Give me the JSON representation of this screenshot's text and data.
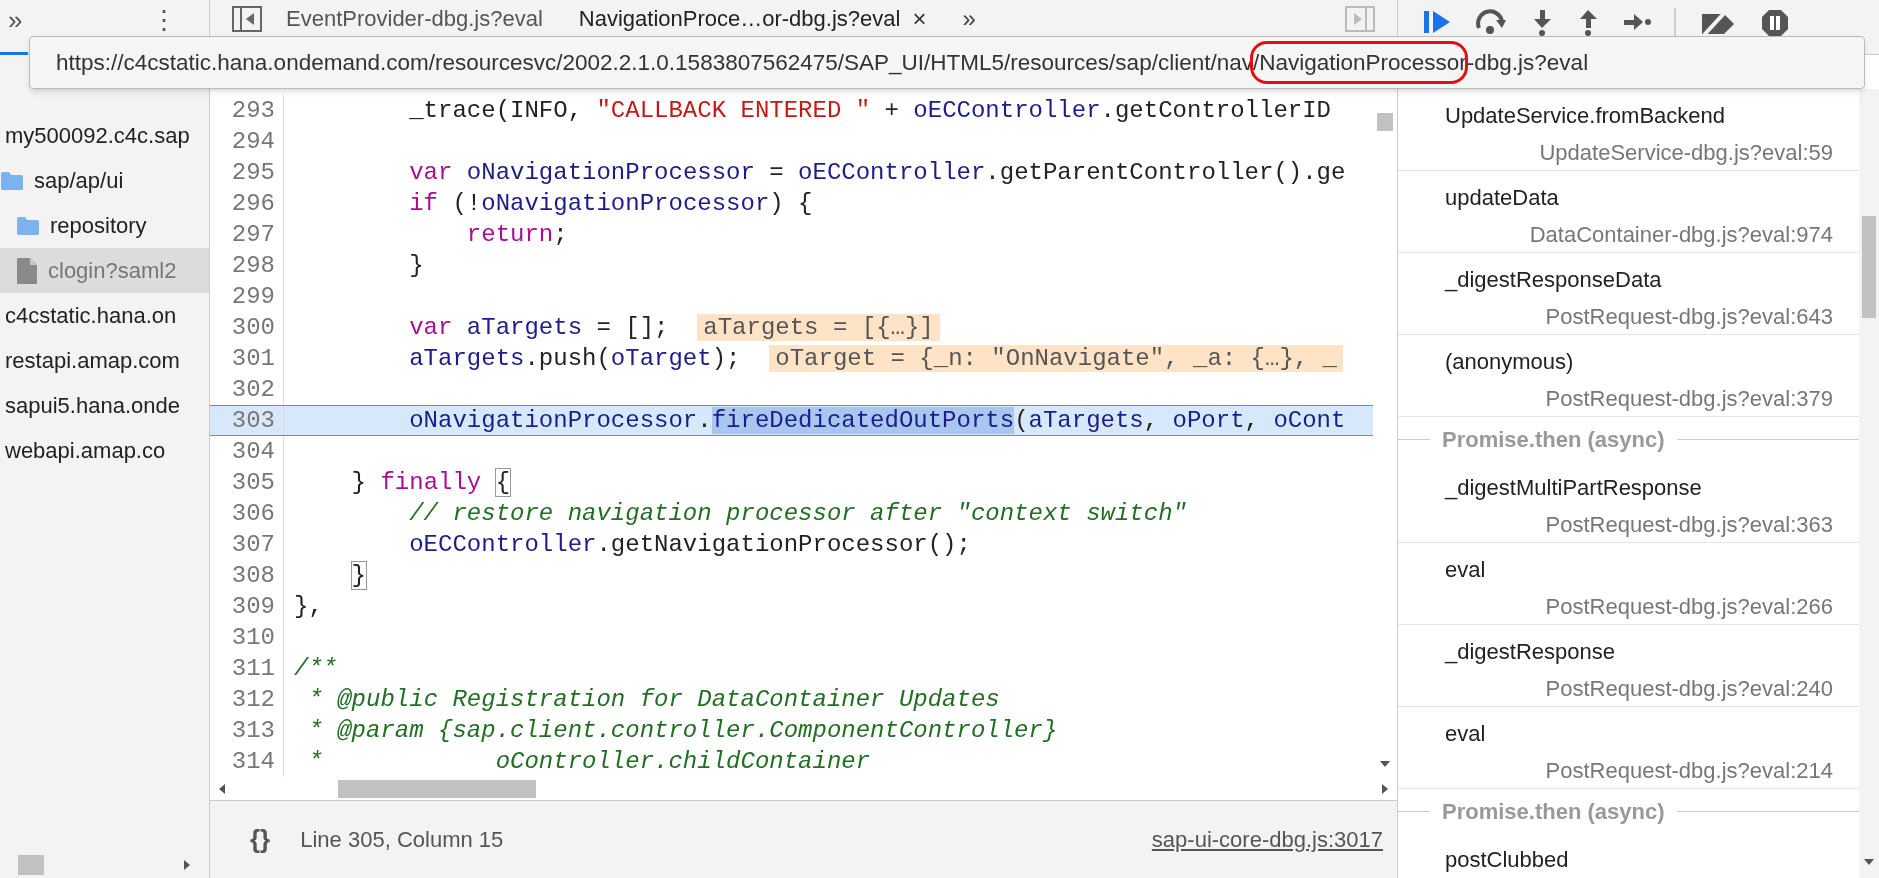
{
  "sidebar": {
    "overflow_glyph": "»",
    "menu_glyph": "⋮",
    "tree": [
      {
        "label": "my500092.c4c.sap",
        "selected": false,
        "children": [
          {
            "label": "sap/ap/ui",
            "kind": "folder",
            "selected": false,
            "children": [
              {
                "label": "repository",
                "kind": "folder",
                "selected": false
              },
              {
                "label": "clogin?saml2",
                "kind": "file",
                "selected": true
              }
            ]
          }
        ]
      },
      {
        "label": "c4cstatic.hana.on",
        "selected": false
      },
      {
        "label": "restapi.amap.com",
        "selected": false
      },
      {
        "label": "sapui5.hana.onde",
        "selected": false
      },
      {
        "label": "webapi.amap.co",
        "selected": false
      }
    ]
  },
  "editor": {
    "tabs": [
      {
        "label": "EventProvider-dbg.js?eval",
        "selected": false
      },
      {
        "label": "NavigationProce…or-dbg.js?eval",
        "selected": true,
        "close_glyph": "×"
      }
    ],
    "more_tabs_glyph": "»",
    "lines": [
      {
        "number": "293",
        "tokens": [
          {
            "kind": "plain",
            "text": "        _trace(INFO, "
          },
          {
            "kind": "string",
            "text": "\"CALLBACK ENTERED \""
          },
          {
            "kind": "plain",
            "text": " + "
          },
          {
            "kind": "variable",
            "text": "oECController"
          },
          {
            "kind": "plain",
            "text": ".getControllerID"
          }
        ]
      },
      {
        "number": "294"
      },
      {
        "number": "295",
        "tokens": [
          {
            "kind": "keyword",
            "text": "        var"
          },
          {
            "kind": "variable",
            "text": " oNavigationProcessor"
          },
          {
            "kind": "plain",
            "text": " = "
          },
          {
            "kind": "variable",
            "text": "oECController"
          },
          {
            "kind": "plain",
            "text": ".getParentController().ge"
          }
        ]
      },
      {
        "number": "296",
        "tokens": [
          {
            "kind": "keyword",
            "text": "        if"
          },
          {
            "kind": "plain",
            "text": " (!"
          },
          {
            "kind": "variable",
            "text": "oNavigationProcessor"
          },
          {
            "kind": "plain",
            "text": ") {"
          }
        ]
      },
      {
        "number": "297",
        "tokens": [
          {
            "kind": "keyword",
            "text": "            return"
          },
          {
            "kind": "plain",
            "text": ";"
          }
        ]
      },
      {
        "number": "298",
        "tokens": [
          {
            "kind": "plain",
            "text": "        }"
          }
        ]
      },
      {
        "number": "299"
      },
      {
        "number": "300",
        "tokens": [
          {
            "kind": "keyword",
            "text": "        var"
          },
          {
            "kind": "variable",
            "text": " aTargets"
          },
          {
            "kind": "plain",
            "text": " = [];  "
          },
          {
            "kind": "inline_value",
            "text": "aTargets = [{…}]"
          }
        ]
      },
      {
        "number": "301",
        "tokens": [
          {
            "kind": "variable",
            "text": "        aTargets"
          },
          {
            "kind": "plain",
            "text": ".push("
          },
          {
            "kind": "variable",
            "text": "oTarget"
          },
          {
            "kind": "plain",
            "text": ");  "
          },
          {
            "kind": "inline_value",
            "text": "oTarget = {_n: \"OnNavigate\", _a: {…}, _"
          }
        ]
      },
      {
        "number": "302"
      },
      {
        "number": "303",
        "selected": true,
        "tokens": [
          {
            "kind": "variable",
            "text": "        oNavigationProcessor"
          },
          {
            "kind": "plain",
            "text": "."
          },
          {
            "kind": "selection",
            "text": "fireDedicatedOutPorts"
          },
          {
            "kind": "plain",
            "text": "("
          },
          {
            "kind": "variable",
            "text": "aTargets"
          },
          {
            "kind": "plain",
            "text": ", "
          },
          {
            "kind": "variable",
            "text": "oPort"
          },
          {
            "kind": "plain",
            "text": ", "
          },
          {
            "kind": "variable",
            "text": "oCont"
          }
        ]
      },
      {
        "number": "304"
      },
      {
        "number": "305",
        "tokens": [
          {
            "kind": "plain",
            "text": "    } "
          },
          {
            "kind": "keyword",
            "text": "finally "
          },
          {
            "kind": "bracket_match",
            "text": "{"
          }
        ]
      },
      {
        "number": "306",
        "tokens": [
          {
            "kind": "comment",
            "text": "        // restore navigation processor after \"context switch\""
          }
        ]
      },
      {
        "number": "307",
        "tokens": [
          {
            "kind": "variable",
            "text": "        oECController"
          },
          {
            "kind": "plain",
            "text": ".getNavigationProcessor();"
          }
        ]
      },
      {
        "number": "308",
        "tokens": [
          {
            "kind": "bracket_match",
            "text": "    }"
          }
        ]
      },
      {
        "number": "309",
        "tokens": [
          {
            "kind": "plain",
            "text": "},"
          }
        ]
      },
      {
        "number": "310"
      },
      {
        "number": "311",
        "tokens": [
          {
            "kind": "comment",
            "text": "/**"
          }
        ]
      },
      {
        "number": "312",
        "tokens": [
          {
            "kind": "comment",
            "text": " * @public Registration for DataContainer Updates"
          }
        ]
      },
      {
        "number": "313",
        "tokens": [
          {
            "kind": "comment",
            "text": " * @param {sap.client.controller.ComponentController}"
          }
        ]
      },
      {
        "number": "314",
        "tokens": [
          {
            "kind": "comment",
            "text": " *            oController.childContainer"
          }
        ]
      }
    ],
    "status": {
      "pretty_print_glyph": "{}",
      "position": "Line 305, Column 15",
      "source_link": "sap-ui-core-dbg.js:3017"
    }
  },
  "call_stack": [
    {
      "kind": "frame",
      "name": "UpdateService.fromBackend",
      "location": "UpdateService-dbg.js?eval:59"
    },
    {
      "kind": "frame",
      "name": "updateData",
      "location": "DataContainer-dbg.js?eval:974"
    },
    {
      "kind": "frame",
      "name": "_digestResponseData",
      "location": "PostRequest-dbg.js?eval:643"
    },
    {
      "kind": "frame",
      "name": "(anonymous)",
      "location": "PostRequest-dbg.js?eval:379"
    },
    {
      "kind": "async",
      "name": "Promise.then (async)"
    },
    {
      "kind": "frame",
      "name": "_digestMultiPartResponse",
      "location": "PostRequest-dbg.js?eval:363"
    },
    {
      "kind": "frame",
      "name": "eval",
      "location": "PostRequest-dbg.js?eval:266"
    },
    {
      "kind": "frame",
      "name": "_digestResponse",
      "location": "PostRequest-dbg.js?eval:240"
    },
    {
      "kind": "frame",
      "name": "eval",
      "location": "PostRequest-dbg.js?eval:214"
    },
    {
      "kind": "async",
      "name": "Promise.then (async)"
    },
    {
      "kind": "frame",
      "name": "postClubbed"
    }
  ],
  "tooltip": {
    "url_start": "https://c4cstatic.hana.ondemand.com/resourcesvc/2002.2.1.0.1583807562475/SAP_UI/HTML5/resources/sap/client/nav/",
    "url_highlighted": "NavigationProcesso",
    "url_end": "r-dbg.js?eval"
  }
}
